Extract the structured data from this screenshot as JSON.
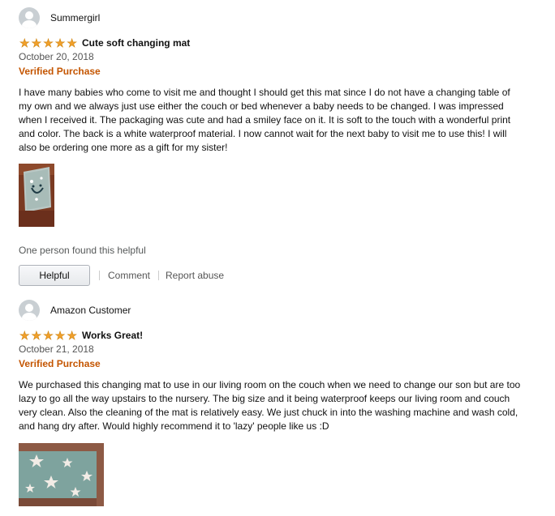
{
  "reviews": [
    {
      "profile_name": "Summergirl",
      "rating_stars": 5,
      "title": "Cute soft changing mat",
      "date": "October 20, 2018",
      "badge": "Verified Purchase",
      "body": "I have many babies who come to visit me and thought I should get this mat since I do not have a changing table of my own and we always just use either the couch or bed whenever a baby needs to be changed. I was impressed when I received it. The packaging was cute and had a smiley face on it. It is soft to the touch with a wonderful print and color. The back is a white waterproof material. I now cannot wait for the next baby to visit me to use this! I will also be ordering one more as a gift for my sister!",
      "helpful_text": "One person found this helpful",
      "helpful_label": "Helpful",
      "comment_label": "Comment",
      "report_label": "Report abuse"
    },
    {
      "profile_name": "Amazon Customer",
      "rating_stars": 5,
      "title": "Works Great!",
      "date": "October 21, 2018",
      "badge": "Verified Purchase",
      "body": "We purchased this changing mat to use in our living room on the couch when we need to change our son but are too lazy to go all the way upstairs to the nursery. The big size and it being waterproof keeps our living room and couch very clean. Also the cleaning of the mat is relatively easy. We just chuck in into the washing machine and wash cold, and hang dry after. Would highly recommend it to 'lazy' people like us :D"
    }
  ],
  "colors": {
    "star": "#f1a02b",
    "verified": "#c45500",
    "muted": "#565959"
  }
}
